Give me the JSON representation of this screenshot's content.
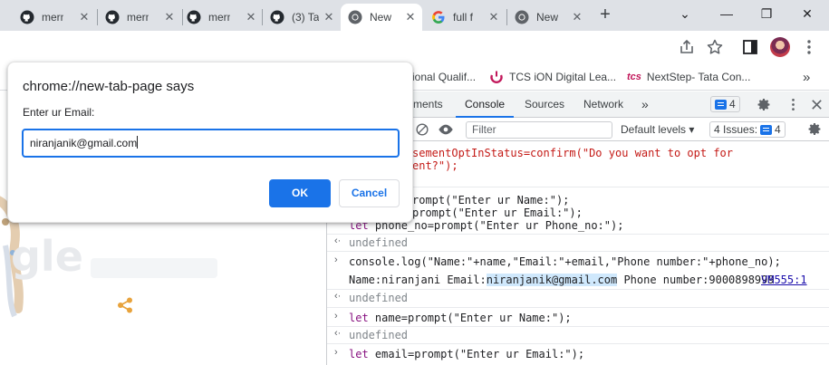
{
  "colors": {
    "accent": "#1a73e8",
    "tab_strip": "#dee1e6"
  },
  "tabs": [
    {
      "label": "mern",
      "icon": "github-icon"
    },
    {
      "label": "mern",
      "icon": "github-icon"
    },
    {
      "label": "mern",
      "icon": "github-icon"
    },
    {
      "label": "(3) Ta",
      "icon": "github-icon"
    },
    {
      "label": "New",
      "icon": "chrome-icon",
      "active": true
    },
    {
      "label": "full f",
      "icon": "google-icon"
    },
    {
      "label": "New",
      "icon": "chrome-icon"
    }
  ],
  "bookmarks": [
    {
      "label": "ional Qualif..."
    },
    {
      "label": "TCS iON Digital Lea..."
    },
    {
      "label": "NextStep- Tata Con..."
    }
  ],
  "bookmark_tcs_logo": "tcs",
  "devtools": {
    "tabs": [
      "ments",
      "Console",
      "Sources",
      "Network"
    ],
    "active_tab": "Console",
    "messages_count": "4",
    "filter_placeholder": "Filter",
    "levels": "Default levels ▾",
    "issues_label": "4 Issues:",
    "issues_count": "4",
    "console": {
      "l1a": "sementOptInStatus=confirm(\"Do you want to opt for",
      "l1b": "ent?\");",
      "l2": "rompt(\"Enter ur Name:\");",
      "l3": "prompt(\"Enter ur Email:\");",
      "l4_kw": "let",
      "l4": " phone_no=prompt(\"Enter ur Phone_no:\");",
      "undefined": "undefined",
      "log_cmd": "console.log(\"Name:\"+name,\"Email:\"+email,\"Phone number:\"+phone_no);",
      "log_out_a": "Name:niranjani Email:",
      "log_out_hl": "niranjanik@gmail.com",
      "log_out_b": " Phone number:9000898999",
      "log_src": "VM555:1",
      "cmd_name_kw": "let",
      "cmd_name": " name=prompt(\"Enter ur Name:\");",
      "cmd_email_kw": "let",
      "cmd_email": " email=prompt(\"Enter ur Email:\");"
    }
  },
  "dialog": {
    "title": "chrome://new-tab-page says",
    "message": "Enter ur Email:",
    "input_value": "niranjanik@gmail.com",
    "ok_label": "OK",
    "cancel_label": "Cancel"
  }
}
